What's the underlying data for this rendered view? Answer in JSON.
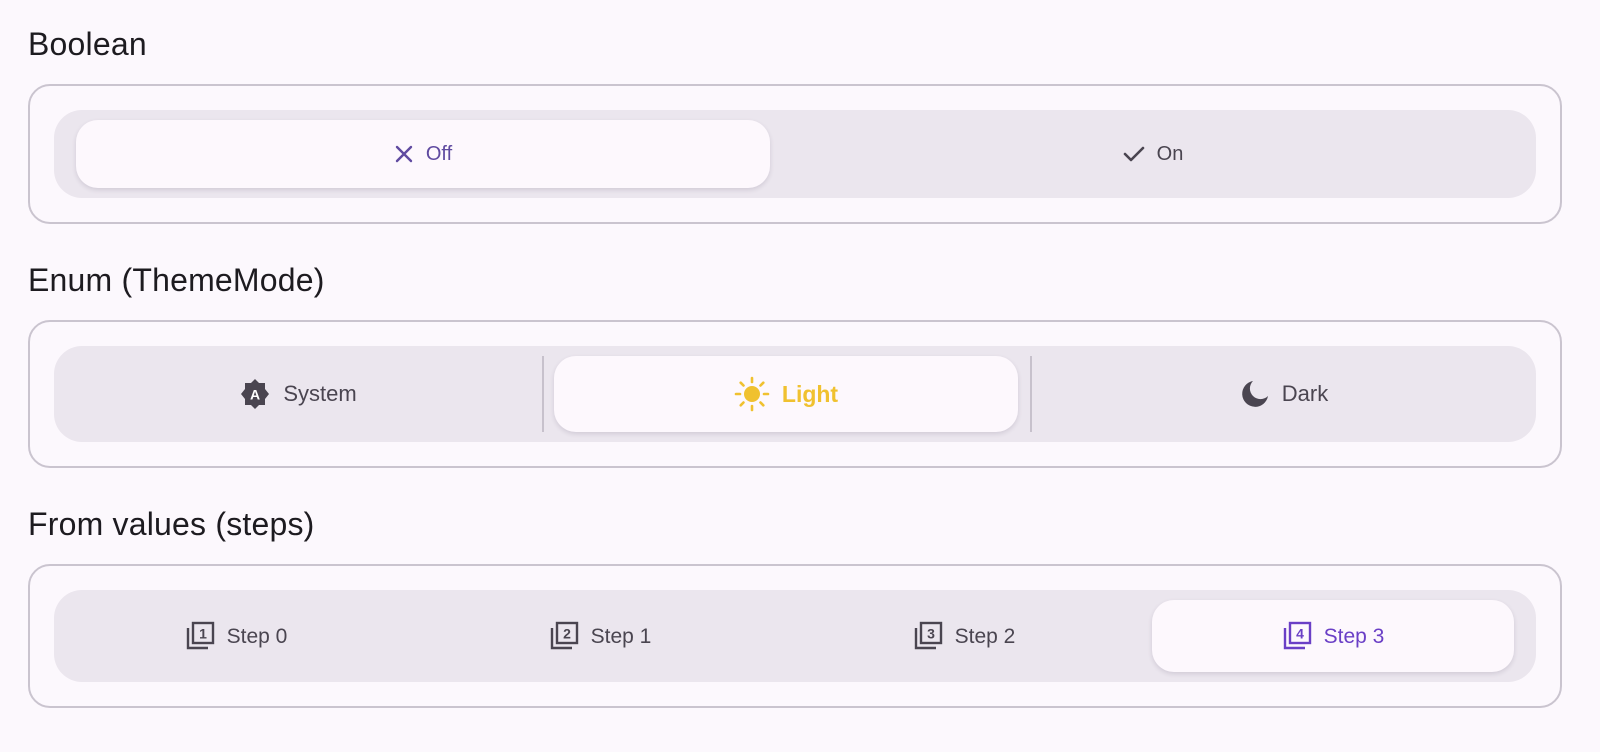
{
  "colors": {
    "background": "#fcf8fd",
    "primary": "#5f4aa0",
    "sun": "#f0c12f",
    "step_accent": "#6a3fc6",
    "text_muted": "#4a4550"
  },
  "sections": {
    "boolean": {
      "title": "Boolean",
      "options": [
        {
          "label": "Off",
          "icon": "close-icon",
          "selected": true
        },
        {
          "label": "On",
          "icon": "check-icon",
          "selected": false
        }
      ]
    },
    "enum": {
      "title": "Enum (ThemeMode)",
      "options": [
        {
          "label": "System",
          "icon": "brightness-auto-icon",
          "icon_letter": "A",
          "selected": false
        },
        {
          "label": "Light",
          "icon": "sun-icon",
          "selected": true
        },
        {
          "label": "Dark",
          "icon": "moon-icon",
          "selected": false
        }
      ]
    },
    "steps": {
      "title": "From values (steps)",
      "options": [
        {
          "label": "Step 0",
          "icon": "filter-1-icon",
          "digit": "1",
          "selected": false
        },
        {
          "label": "Step 1",
          "icon": "filter-2-icon",
          "digit": "2",
          "selected": false
        },
        {
          "label": "Step 2",
          "icon": "filter-3-icon",
          "digit": "3",
          "selected": false
        },
        {
          "label": "Step 3",
          "icon": "filter-4-icon",
          "digit": "4",
          "selected": true
        }
      ]
    }
  }
}
